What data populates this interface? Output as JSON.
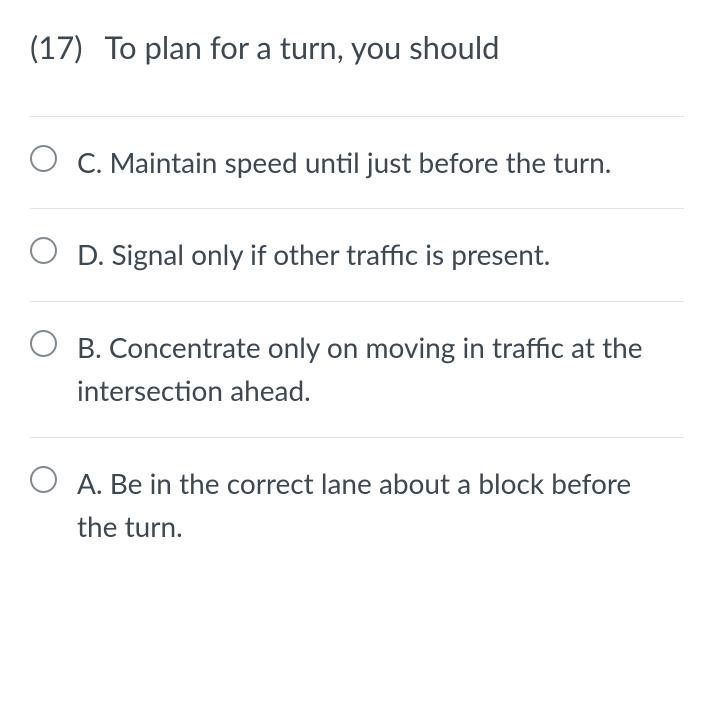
{
  "question": {
    "number": "(17)",
    "text": "To plan for a turn, you should"
  },
  "options": [
    {
      "label": "C. Maintain speed until just before the turn."
    },
    {
      "label": "D. Signal only if other traffic is present."
    },
    {
      "label": "B. Concentrate only on moving in traffic at the intersection ahead."
    },
    {
      "label": "A. Be in the correct lane about a block before the turn."
    }
  ]
}
